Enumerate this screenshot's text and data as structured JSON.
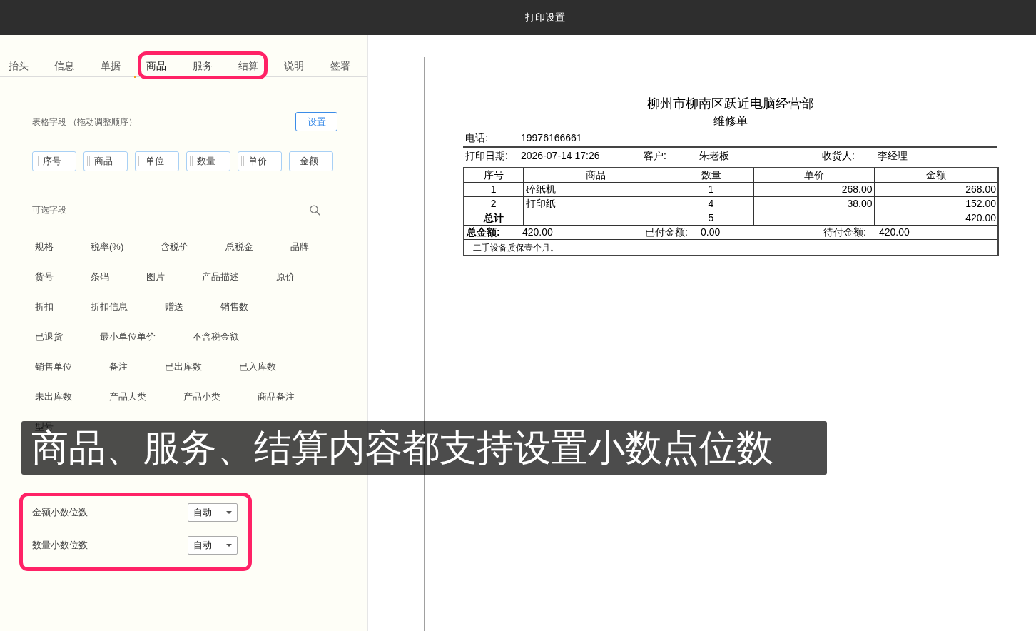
{
  "window": {
    "title": "打印设置"
  },
  "tabs": [
    {
      "label": "抬头",
      "selected": false
    },
    {
      "label": "信息",
      "selected": false
    },
    {
      "label": "单据",
      "selected": false
    },
    {
      "label": "商品",
      "selected": true
    },
    {
      "label": "服务",
      "selected": false
    },
    {
      "label": "结算",
      "selected": false
    },
    {
      "label": "说明",
      "selected": false
    },
    {
      "label": "签署",
      "selected": false
    }
  ],
  "table_fields": {
    "label": "表格字段 （拖动调整顺序）",
    "settings_button": "设置",
    "fields": [
      "序号",
      "商品",
      "单位",
      "数量",
      "单价",
      "金额"
    ]
  },
  "optional_fields": {
    "label": "可选字段",
    "rows": [
      [
        "规格",
        "税率(%)",
        "含税价",
        "总税金",
        "品牌"
      ],
      [
        "货号",
        "条码",
        "图片",
        "产品描述",
        "原价"
      ],
      [
        "折扣",
        "折扣信息",
        "赠送",
        "销售数"
      ],
      [
        "已退货",
        "最小单位单价",
        "不含税金额"
      ],
      [
        "销售单位",
        "备注",
        "已出库数",
        "已入库数"
      ],
      [
        "未出库数",
        "产品大类",
        "产品小类",
        "商品备注"
      ],
      [
        "型号"
      ]
    ]
  },
  "decimal_settings": [
    {
      "label": "金额小数位数",
      "value": "自动"
    },
    {
      "label": "数量小数位数",
      "value": "自动"
    }
  ],
  "receipt": {
    "title": "柳州市柳南区跃近电脑经营部",
    "subtitle": "维修单",
    "phone": {
      "label": "电话:",
      "value": "19976166661"
    },
    "info": [
      {
        "label": "打印日期:",
        "value": "2026-07-14 17:26"
      },
      {
        "label": "客户:",
        "value": "朱老板"
      },
      {
        "label": "收货人:",
        "value": "李经理"
      }
    ],
    "table": {
      "columns": [
        {
          "label": "序号",
          "kind": "index"
        },
        {
          "label": "商品",
          "kind": "name"
        },
        {
          "label": "数量",
          "kind": "quantity"
        },
        {
          "label": "单价",
          "kind": "price"
        },
        {
          "label": "金额",
          "kind": "amount"
        }
      ],
      "rows": [
        {
          "index": "1",
          "name": "碎纸机",
          "quantity": "1",
          "price": "268.00",
          "amount": "268.00"
        },
        {
          "index": "2",
          "name": "打印纸",
          "quantity": "4",
          "price": "38.00",
          "amount": "152.00"
        }
      ],
      "total_row": {
        "index": "总计",
        "quantity": "5",
        "amount": "420.00"
      }
    },
    "summary": [
      {
        "kind": "total",
        "label": "总金额:",
        "value": "420.00"
      },
      {
        "kind": "paid",
        "label": "已付金额:",
        "value": "0.00"
      },
      {
        "kind": "due",
        "label": "待付金额:",
        "value": "420.00"
      }
    ],
    "note": "二手设备质保壹个月。"
  },
  "caption": "商品、服务、结算内容都支持设置小数点位数"
}
